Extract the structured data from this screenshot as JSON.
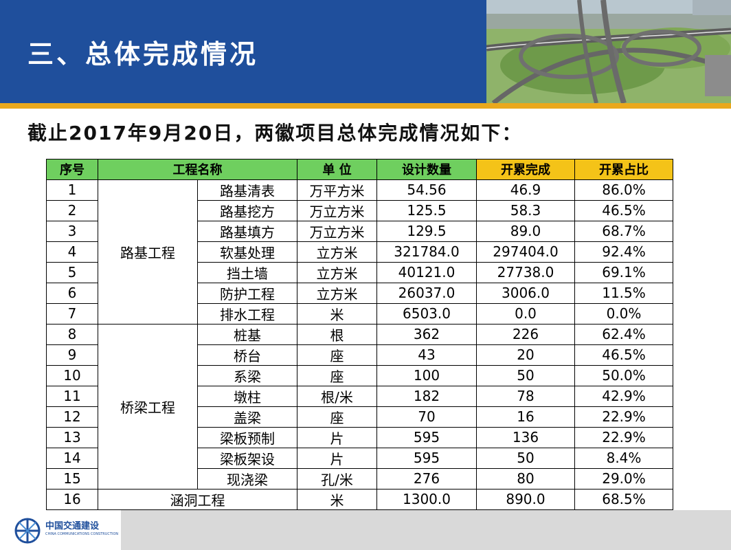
{
  "header": {
    "title": "三、总体完成情况"
  },
  "subtitle": "截止2017年9月20日，两徽项目总体完成情况如下：",
  "table": {
    "headers": {
      "seq": "序号",
      "name": "工程名称",
      "unit": "单 位",
      "design": "设计数量",
      "completed": "开累完成",
      "ratio": "开累占比"
    },
    "categories": {
      "roadbed": "路基工程",
      "bridge": "桥梁工程"
    },
    "rows": [
      {
        "seq": "1",
        "item": "路基清表",
        "unit": "万平方米",
        "design": "54.56",
        "completed": "46.9",
        "ratio": "86.0%"
      },
      {
        "seq": "2",
        "item": "路基挖方",
        "unit": "万立方米",
        "design": "125.5",
        "completed": "58.3",
        "ratio": "46.5%"
      },
      {
        "seq": "3",
        "item": "路基填方",
        "unit": "万立方米",
        "design": "129.5",
        "completed": "89.0",
        "ratio": "68.7%"
      },
      {
        "seq": "4",
        "item": "软基处理",
        "unit": "立方米",
        "design": "321784.0",
        "completed": "297404.0",
        "ratio": "92.4%"
      },
      {
        "seq": "5",
        "item": "挡土墙",
        "unit": "立方米",
        "design": "40121.0",
        "completed": "27738.0",
        "ratio": "69.1%"
      },
      {
        "seq": "6",
        "item": "防护工程",
        "unit": "立方米",
        "design": "26037.0",
        "completed": "3006.0",
        "ratio": "11.5%"
      },
      {
        "seq": "7",
        "item": "排水工程",
        "unit": "米",
        "design": "6503.0",
        "completed": "0.0",
        "ratio": "0.0%"
      },
      {
        "seq": "8",
        "item": "桩基",
        "unit": "根",
        "design": "362",
        "completed": "226",
        "ratio": "62.4%"
      },
      {
        "seq": "9",
        "item": "桥台",
        "unit": "座",
        "design": "43",
        "completed": "20",
        "ratio": "46.5%"
      },
      {
        "seq": "10",
        "item": "系梁",
        "unit": "座",
        "design": "100",
        "completed": "50",
        "ratio": "50.0%"
      },
      {
        "seq": "11",
        "item": "墩柱",
        "unit": "根/米",
        "design": "182",
        "completed": "78",
        "ratio": "42.9%"
      },
      {
        "seq": "12",
        "item": "盖梁",
        "unit": "座",
        "design": "70",
        "completed": "16",
        "ratio": "22.9%"
      },
      {
        "seq": "13",
        "item": "梁板预制",
        "unit": "片",
        "design": "595",
        "completed": "136",
        "ratio": "22.9%"
      },
      {
        "seq": "14",
        "item": "梁板架设",
        "unit": "片",
        "design": "595",
        "completed": "50",
        "ratio": "8.4%"
      },
      {
        "seq": "15",
        "item": "现浇梁",
        "unit": "孔/米",
        "design": "276",
        "completed": "80",
        "ratio": "29.0%"
      }
    ],
    "last_row": {
      "seq": "16",
      "name": "涵洞工程",
      "unit": "米",
      "design": "1300.0",
      "completed": "890.0",
      "ratio": "68.5%"
    }
  },
  "footer": {
    "logo_cn": "中国交通建设",
    "logo_en": "CHINA COMMUNICATIONS CONSTRUCTION",
    "logo_icon": "cccc-logo-icon"
  },
  "colors": {
    "header_blue": "#1f4f9c",
    "band_gold": "#e9a81d",
    "header_green": "#6fcf5f",
    "header_yellow": "#f4c318"
  }
}
